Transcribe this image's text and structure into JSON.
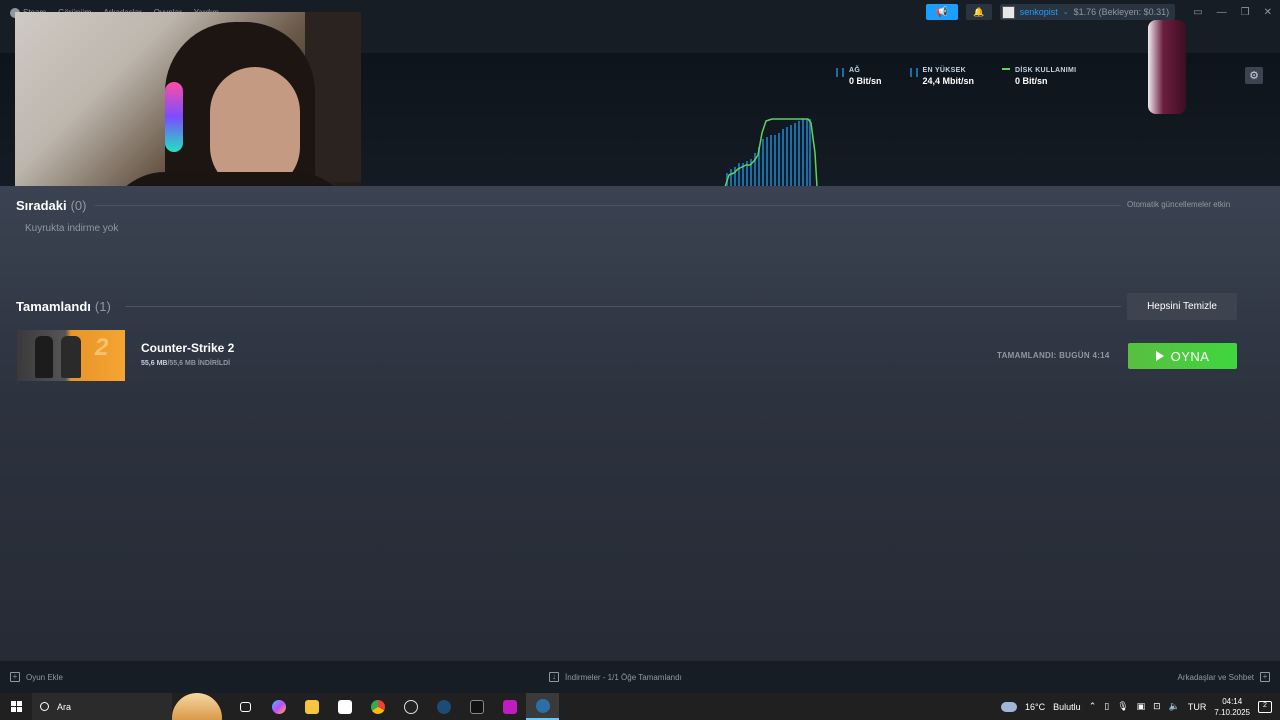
{
  "menu": {
    "items": [
      "Steam",
      "Görünüm",
      "Arkadaşlar",
      "Oyunlar",
      "Yardım"
    ]
  },
  "account": {
    "username": "senkopist",
    "wallet": "$1.76 (Bekleyen: $0.31)"
  },
  "stats": {
    "network_label": "AĞ",
    "network_value": "0 Bit/sn",
    "peak_label": "EN YÜKSEK",
    "peak_value": "24,4 Mbit/sn",
    "disk_label": "DİSK KULLANIMI",
    "disk_value": "0 Bit/sn",
    "bar_color": "#1a6ea8",
    "line_color": "#5ed35e"
  },
  "queue": {
    "title": "Sıradaki",
    "count": "(0)",
    "auto_updates": "Otomatik güncellemeler etkin",
    "empty_text": "Kuyrukta indirme yok"
  },
  "completed": {
    "title": "Tamamlandı",
    "count": "(1)",
    "clear_all": "Hepsini Temizle",
    "items": [
      {
        "name": "Counter-Strike 2",
        "downloaded": "55,6 MB",
        "total": "/55,6 MB İNDİRİLDİ",
        "status": "TAMAMLANDI: BUGÜN 4:14",
        "play_label": "OYNA",
        "thumb_text": "2"
      }
    ]
  },
  "footer": {
    "add_game": "Oyun Ekle",
    "downloads_status": "İndirmeler - 1/1 Öğe Tamamlandı",
    "friends_chat": "Arkadaşlar ve Sohbet"
  },
  "taskbar": {
    "search_label": "Ara",
    "temperature": "16°C",
    "weather": "Bulutlu",
    "language": "TUR",
    "time": "04:14",
    "date": "7.10.2025",
    "notification_count": "2"
  },
  "colors": {
    "accent": "#1a9fff",
    "play_green": "#3fd63f",
    "background": "#1b2838"
  }
}
